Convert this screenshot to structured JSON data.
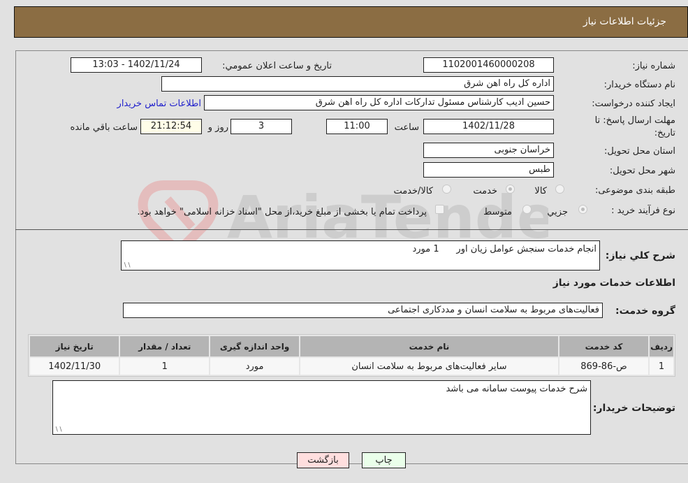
{
  "header": {
    "title": "جزئیات اطلاعات نیاز"
  },
  "form": {
    "need_number": {
      "label": "شماره نیاز:",
      "value": "1102001460000208"
    },
    "announce_datetime": {
      "label": "تاریخ و ساعت اعلان عمومي:",
      "value": "1402/11/24 - 13:03"
    },
    "buyer_org": {
      "label": "نام دستگاه خریدار:",
      "value": "اداره کل راه اهن شرق"
    },
    "requester": {
      "label": "ایجاد کننده درخواست:",
      "value": "حسین ادیب کارشناس مسئول تدارکات اداره کل راه اهن شرق"
    },
    "buyer_contact_link": "اطلاعات تماس خریدار",
    "deadline": {
      "label_line1": "مهلت ارسال پاسخ: تا",
      "label_line2": "تاریخ:",
      "date": "1402/11/28",
      "time_label": "ساعت",
      "time": "11:00",
      "days": "3",
      "days_label": "روز و",
      "remaining": "21:12:54",
      "remaining_label": "ساعت باقي مانده"
    },
    "province": {
      "label": "استان محل تحویل:",
      "value": "خراسان جنوبی"
    },
    "city": {
      "label": "شهر محل تحویل:",
      "value": "طبس"
    },
    "category": {
      "label": "طبقه بندی موضوعی:",
      "options": [
        "کالا",
        "خدمت",
        "کالا/خدمت"
      ],
      "selected": "خدمت"
    },
    "purchase_type": {
      "label": "نوع فرآیند خرید :",
      "options": [
        "جزيي",
        "متوسط"
      ],
      "selected": "جزيي",
      "treasury_note": "پرداخت تمام یا بخشی از مبلغ خرید،از محل \"اسناد خزانه اسلامی\" خواهد بود."
    }
  },
  "summary": {
    "label": "شرح كلي نياز:",
    "value": "انجام خدمات سنجش عوامل زیان اور      1 مورد"
  },
  "services_section": {
    "title": "اطلاعات خدمات مورد نياز",
    "group_label": "گروه خدمت:",
    "group_value": "فعالیت‌های مربوط به سلامت انسان و مددکاری اجتماعی",
    "table": {
      "headers": [
        "ردیف",
        "کد خدمت",
        "نام خدمت",
        "واحد اندازه گیری",
        "تعداد / مقدار",
        "تاریخ نیاز"
      ],
      "rows": [
        [
          "1",
          "ص-86-869",
          "سایر فعالیت‌های مربوط به سلامت انسان",
          "مورد",
          "1",
          "1402/11/30"
        ]
      ]
    }
  },
  "buyer_notes": {
    "label": "توضیحات خریدار:",
    "value": "شرح خدمات پیوست سامانه می باشد"
  },
  "buttons": {
    "print": "چاپ",
    "back": "بازگشت"
  },
  "watermark": {
    "text": "AriaTender.neT"
  },
  "colors": {
    "header_bg": "#8b6d43",
    "print_bg": "#eaffea",
    "back_bg": "#ffdede",
    "link": "#2222cc"
  }
}
